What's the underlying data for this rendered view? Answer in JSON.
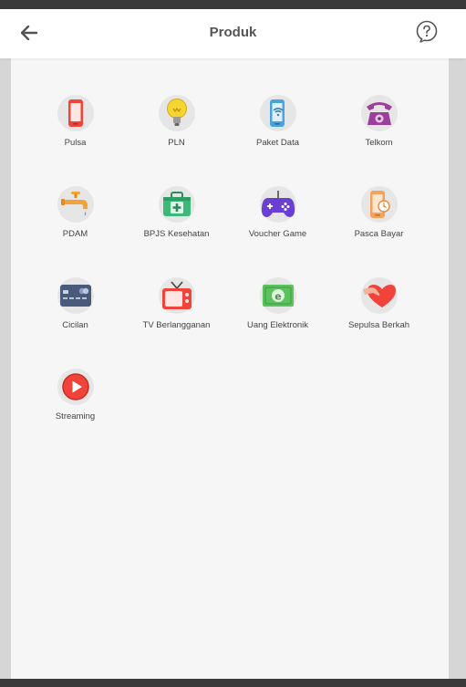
{
  "header": {
    "title": "Produk"
  },
  "products": [
    {
      "label": "Pulsa",
      "icon": "mobile-phone-icon"
    },
    {
      "label": "PLN",
      "icon": "light-bulb-icon"
    },
    {
      "label": "Paket Data",
      "icon": "phone-wifi-icon"
    },
    {
      "label": "Telkom",
      "icon": "telephone-icon"
    },
    {
      "label": "PDAM",
      "icon": "water-faucet-icon"
    },
    {
      "label": "BPJS Kesehatan",
      "icon": "medical-kit-icon"
    },
    {
      "label": "Voucher Game",
      "icon": "gamepad-icon"
    },
    {
      "label": "Pasca Bayar",
      "icon": "phone-clock-icon"
    },
    {
      "label": "Cicilan",
      "icon": "card-icon"
    },
    {
      "label": "TV Berlangganan",
      "icon": "tv-icon"
    },
    {
      "label": "Uang Elektronik",
      "icon": "e-money-icon"
    },
    {
      "label": "Sepulsa Berkah",
      "icon": "heart-hand-icon"
    },
    {
      "label": "Streaming",
      "icon": "play-icon"
    }
  ],
  "colors": {
    "red": "#f0443a",
    "yellow": "#f5d631",
    "blue": "#4aa3df",
    "purple": "#9c3f9a",
    "orange": "#f3a33b",
    "green": "#3cb878",
    "violet": "#6c3fd4"
  }
}
